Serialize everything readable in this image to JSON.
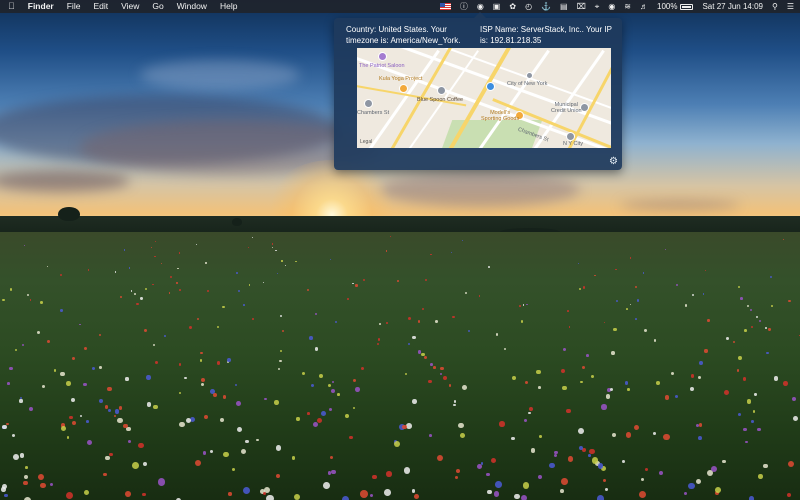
{
  "menubar": {
    "apple_icon": "apple-logo-icon",
    "app_name": "Finder",
    "menus": [
      "File",
      "Edit",
      "View",
      "Go",
      "Window",
      "Help"
    ],
    "status": {
      "battery_percent": "100%",
      "date_time": "Sat 27 Jun  14:09",
      "icons": [
        "us-flag-icon",
        "info-icon",
        "eye-icon",
        "box-icon",
        "fan-icon",
        "clock-icon",
        "anchor-icon",
        "document-icon",
        "xmark-square-icon",
        "crop-icon",
        "camera-icon",
        "wifi-icon",
        "volume-icon",
        "battery-icon",
        "spotlight-search-icon",
        "notification-list-icon"
      ]
    }
  },
  "popover": {
    "country_text": "Country: United States. Your timezone is: America/New_York.",
    "isp_text": "ISP Name: ServerStack, Inc.. Your IP is: 192.81.218.35",
    "map": {
      "labels": {
        "patriot": "The Patriot Saloon",
        "kula": "Kula Yoga Project",
        "city": "City of New York",
        "bluespoon": "Blue Spoon Coffee",
        "municipal": "Municipal\nCredit Union",
        "chambers_w": "Chambers St",
        "modells": "Modell's\nSporting Goods",
        "chambers_e": "Chambers St",
        "nycity": "N Y City",
        "legal": "Legal"
      },
      "colors": {
        "land": "#efe9df",
        "park": "#c9dfb2",
        "road": "#f7d56a",
        "pin_purple": "#a37bd0",
        "pin_orange": "#f2a93b",
        "pin_blue": "#3d8ee0",
        "pin_gray": "#8e96a3"
      }
    },
    "settings_icon": "gear-icon"
  }
}
